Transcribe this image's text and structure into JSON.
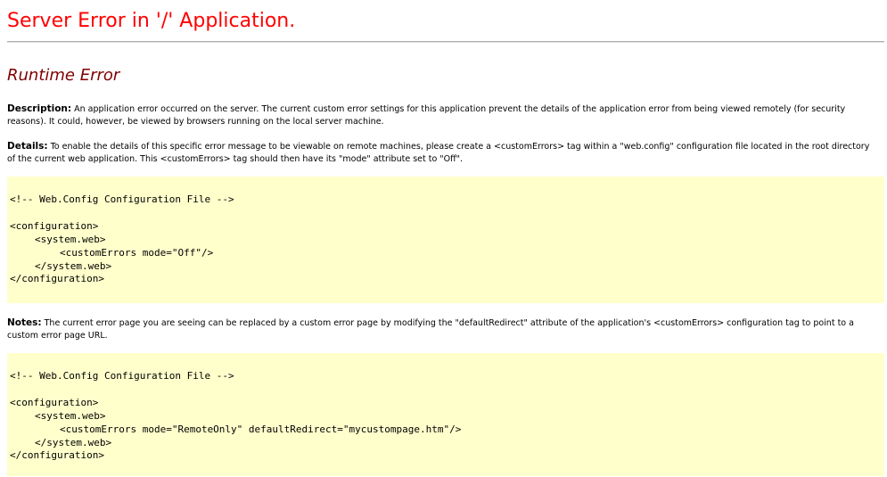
{
  "header": {
    "title": "Server Error in '/' Application.",
    "subtitle": "Runtime Error"
  },
  "description": {
    "label": "Description:",
    "text": " An application error occurred on the server. The current custom error settings for this application prevent the details of the application error from being viewed remotely (for security reasons). It could, however, be viewed by browsers running on the local server machine."
  },
  "details": {
    "label": "Details:",
    "text": " To enable the details of this specific error message to be viewable on remote machines, please create a <customErrors> tag within a \"web.config\" configuration file located in the root directory of the current web application. This <customErrors> tag should then have its \"mode\" attribute set to \"Off\"."
  },
  "code_block_1": {
    "comment": "<!-- Web.Config Configuration File -->",
    "line_configuration_open": "<configuration>",
    "line_system_web_open": "<system.web>",
    "line_custom_errors": "<customErrors mode=\"Off\"/>",
    "line_system_web_close": "</system.web>",
    "line_configuration_close": "</configuration>"
  },
  "notes": {
    "label": "Notes:",
    "text": " The current error page you are seeing can be replaced by a custom error page by modifying the \"defaultRedirect\" attribute of the application's <customErrors> configuration tag to point to a custom error page URL."
  },
  "code_block_2": {
    "comment": "<!-- Web.Config Configuration File -->",
    "line_configuration_open": "<configuration>",
    "line_system_web_open": "<system.web>",
    "line_custom_errors": "<customErrors mode=\"RemoteOnly\" defaultRedirect=\"mycustompage.htm\"/>",
    "line_system_web_close": "</system.web>",
    "line_configuration_close": "</configuration>"
  },
  "colors": {
    "title": "#ff0000",
    "subtitle": "#800000",
    "code_background": "#ffffcc",
    "rule": "#b0b0b0"
  }
}
